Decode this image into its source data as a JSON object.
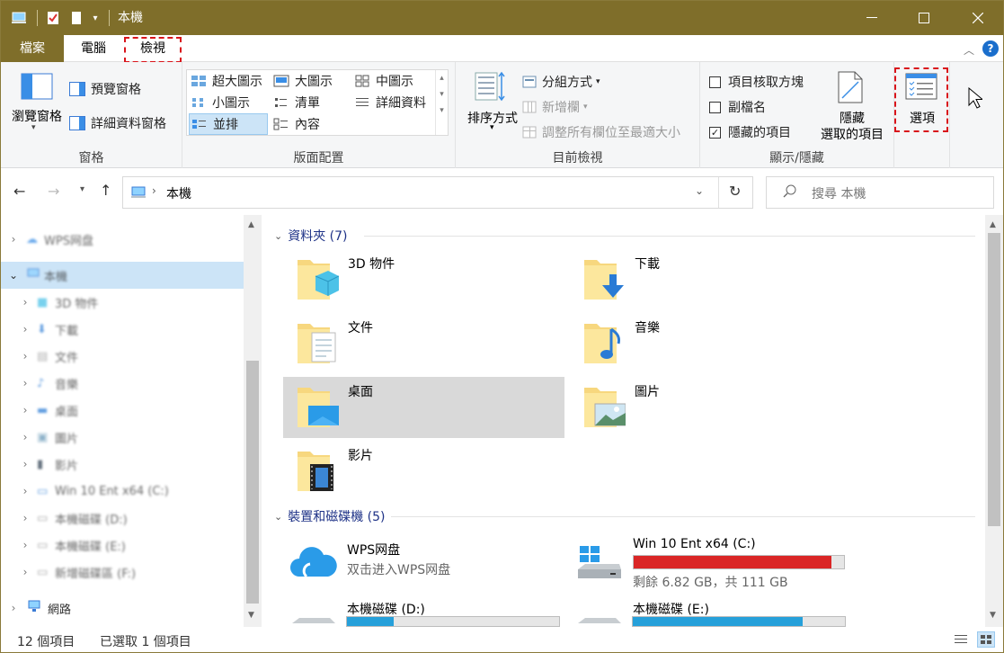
{
  "window": {
    "title": "本機"
  },
  "ribbon_tabs": {
    "file": "檔案",
    "computer": "電腦",
    "view": "檢視"
  },
  "ribbon": {
    "panes": {
      "navigation_pane": "瀏覽窗格",
      "preview_pane": "預覽窗格",
      "details_pane": "詳細資料窗格",
      "group_label": "窗格"
    },
    "layout": {
      "extra_large_icons": "超大圖示",
      "large_icons": "大圖示",
      "medium_icons": "中圖示",
      "small_icons": "小圖示",
      "list": "清單",
      "details": "詳細資料",
      "tiles": "並排",
      "content": "內容",
      "group_label": "版面配置"
    },
    "current_view": {
      "sort_by": "排序方式",
      "group_by": "分組方式",
      "add_columns": "新增欄",
      "size_all_columns": "調整所有欄位至最適大小",
      "group_label": "目前檢視"
    },
    "show_hide": {
      "item_checkboxes": "項目核取方塊",
      "file_extensions": "副檔名",
      "hidden_items": "隱藏的項目",
      "hide_selected_line1": "隱藏",
      "hide_selected_line2": "選取的項目",
      "group_label": "顯示/隱藏",
      "item_checkboxes_checked": false,
      "file_extensions_checked": false,
      "hidden_items_checked": true
    },
    "options": "選項"
  },
  "address": {
    "path": "本機",
    "search_placeholder": "搜尋 本機"
  },
  "nav": {
    "items": [
      {
        "label": "WPS网盘"
      },
      {
        "label": "本機"
      },
      {
        "label": "3D 物件"
      },
      {
        "label": "下載"
      },
      {
        "label": "文件"
      },
      {
        "label": "音樂"
      },
      {
        "label": "桌面"
      },
      {
        "label": "圖片"
      },
      {
        "label": "影片"
      },
      {
        "label": "Win 10 Ent x64 (C:)"
      },
      {
        "label": "本機磁碟 (D:)"
      },
      {
        "label": "本機磁碟 (E:)"
      },
      {
        "label": "新增磁碟區 (F:)"
      },
      {
        "label": "網路"
      }
    ]
  },
  "content": {
    "folders_header": "資料夾 (7)",
    "folders": [
      {
        "name": "3D 物件"
      },
      {
        "name": "下載"
      },
      {
        "name": "文件"
      },
      {
        "name": "音樂"
      },
      {
        "name": "桌面"
      },
      {
        "name": "圖片"
      },
      {
        "name": "影片"
      }
    ],
    "devices_header": "裝置和磁碟機 (5)",
    "devices": [
      {
        "name": "WPS网盘",
        "sub": "双击进入WPS网盘"
      },
      {
        "name": "Win 10 Ent x64 (C:)",
        "sub": "剩餘 6.82 GB，共 111 GB",
        "used_fraction": 0.94,
        "bar_color": "#da2626"
      },
      {
        "name": "本機磁碟 (D:)",
        "used_fraction": 0.22,
        "bar_color": "#26a0da"
      },
      {
        "name": "本機磁碟 (E:)",
        "used_fraction": 0.8,
        "bar_color": "#26a0da"
      }
    ]
  },
  "status": {
    "count": "12 個項目",
    "selected": "已選取 1 個項目"
  },
  "colors": {
    "titlebar": "#7f6e2a",
    "accent_blue": "#26a0da",
    "warning_red": "#da2626",
    "highlight_dash": "#d9141b"
  }
}
